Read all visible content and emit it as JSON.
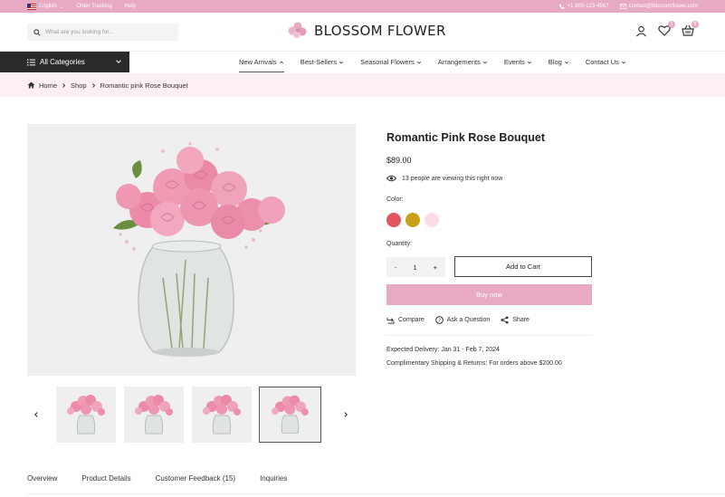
{
  "topbar": {
    "language": "English",
    "order_tracking": "Order Tracking",
    "help": "Help",
    "phone": "+1 800-123-4567",
    "email": "contact@blossomflower.com"
  },
  "header": {
    "search_placeholder": "What are you looking for...",
    "logo_text": "BLOSSOM FLOWER",
    "wishlist_count": "0",
    "cart_count": "0"
  },
  "nav": {
    "all_categories": "All Categories",
    "items": [
      {
        "label": "New Arrivals"
      },
      {
        "label": "Best-Sellers"
      },
      {
        "label": "Seasonal Flowers"
      },
      {
        "label": "Arrangements"
      },
      {
        "label": "Events"
      },
      {
        "label": "Blog"
      },
      {
        "label": "Contact Us"
      }
    ]
  },
  "breadcrumb": {
    "home": "Home",
    "shop": "Shop",
    "current": "Romantic pink Rose Bouquet"
  },
  "product": {
    "title": "Romantic Pink Rose Bouquet",
    "price": "$89.00",
    "viewing": "13 people are viewing this right now",
    "color_label": "Color:",
    "colors": [
      "#e0575f",
      "#c9a21a",
      "#fbdde4"
    ],
    "quantity_label": "Quantity:",
    "quantity": "1",
    "minus": "-",
    "plus": "+",
    "add_to_cart": "Add to Cart",
    "buy_now": "Buy now",
    "compare": "Compare",
    "ask": "Ask a Question",
    "share": "Share",
    "delivery_label": "Expected Delivery:",
    "delivery_value": "Jan 31 - Feb 7, 2024",
    "shipping_label": "Complimentary Shipping & Returns:",
    "shipping_value": "For orders above $200.00"
  },
  "tabs": [
    {
      "label": "Overview"
    },
    {
      "label": "Product Details"
    },
    {
      "label": "Customer Feedback (15)"
    },
    {
      "label": "Inquiries"
    }
  ],
  "colors": {
    "accent": "#e8a9c2",
    "dark": "#2b2b2b",
    "breadcrumb_bg": "#fdf0f5"
  }
}
